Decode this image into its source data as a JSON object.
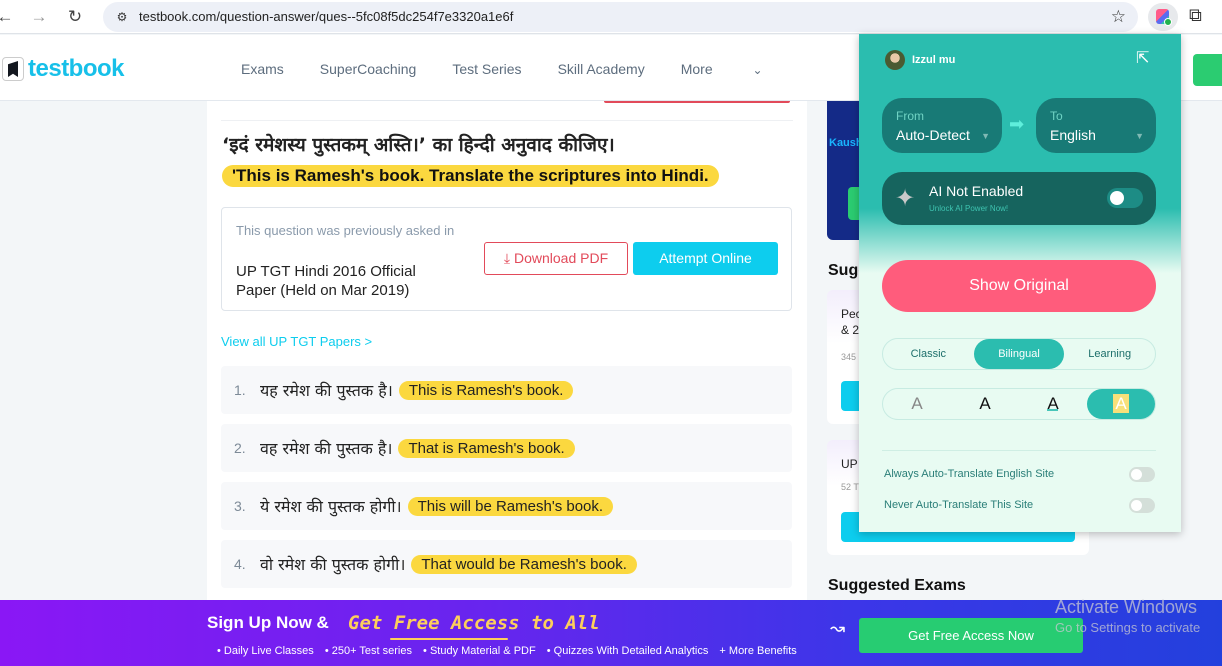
{
  "browser": {
    "url": "testbook.com/question-answer/ques--5fc08f5dc254f7e3320a1e6f",
    "icons": {
      "back": "back-arrow-icon",
      "forward": "forward-arrow-icon",
      "reload": "reload-icon",
      "site_info": "site-settings-icon",
      "bookmark": "star-icon",
      "extension": "translator-extension-icon",
      "extensions": "puzzle-icon"
    }
  },
  "site": {
    "logo": "testbook",
    "nav": [
      "Exams",
      "SuperCoaching",
      "Test Series",
      "Skill Academy",
      "More"
    ]
  },
  "question": {
    "hindi": "‘इदं रमेशस्य पुस्तकम् अस्ति।’ का हिन्दी अनुवाद कीजिए।",
    "translation": "'This is Ramesh's book. Translate the scriptures into Hindi.",
    "previously_asked_label": "This question was previously asked in",
    "paper": "UP TGT Hindi 2016 Official Paper (Held on Mar 2019)",
    "download_pdf": "Download PDF",
    "attempt_online": "Attempt Online",
    "view_all": "View all UP TGT Papers >",
    "options": [
      {
        "num": "1.",
        "hindi": "यह रमेश की पुस्तक है।",
        "translation": "This is Ramesh's book."
      },
      {
        "num": "2.",
        "hindi": "वह रमेश की पुस्तक है।",
        "translation": "That is Ramesh's book."
      },
      {
        "num": "3.",
        "hindi": "ये रमेश की पुस्तक होगी।",
        "translation": "This will be Ramesh's book."
      },
      {
        "num": "4.",
        "hindi": "वो रमेश की पुस्तक होगी।",
        "translation": "That would be Ramesh's book."
      }
    ]
  },
  "sidebar": {
    "ad_text": "Kaush",
    "suggested_heading": "Sugg",
    "cards": [
      {
        "title": "Pec & 2",
        "meta": "345"
      },
      {
        "title": "UP",
        "meta": "52 T"
      }
    ],
    "suggested_exams": "Suggested Exams"
  },
  "translator": {
    "user": "Izzul mu",
    "from_label": "From",
    "from_value": "Auto-Detect",
    "to_label": "To",
    "to_value": "English",
    "ai_title": "AI Not Enabled",
    "ai_subtitle": "Unlock AI Power Now!",
    "ai_enabled": false,
    "show_original": "Show Original",
    "modes": [
      "Classic",
      "Bilingual",
      "Learning"
    ],
    "active_mode": "Bilingual",
    "font_styles": [
      "A",
      "A",
      "A",
      "A"
    ],
    "active_font_style": 4,
    "always_translate": "Always Auto-Translate English Site",
    "always_translate_on": false,
    "never_translate": "Never Auto-Translate This Site",
    "never_translate_on": false,
    "colors": {
      "primary": "#2bbdaf",
      "dark": "#16645e",
      "accent": "#ff5c7c"
    }
  },
  "banner": {
    "title": "Sign Up Now &",
    "highlight": "Get Free Access to All",
    "features": [
      "• Daily Live Classes",
      "• 250+ Test series",
      "• Study Material & PDF",
      "• Quizzes With Detailed Analytics",
      "+ More Benefits"
    ],
    "cta": "Get Free Access Now"
  },
  "watermark": {
    "title": "Activate Windows",
    "subtitle": "Go to Settings to activate"
  }
}
